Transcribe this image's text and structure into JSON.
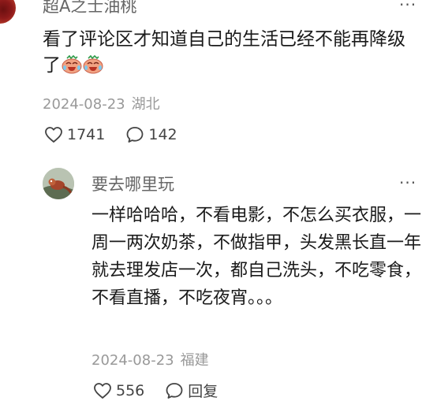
{
  "top_comment": {
    "username": "超A之士油桃",
    "text": "看了评论区才知道自己的生活已经不能再降级了",
    "emoji_count": 2,
    "date": "2024-08-23",
    "location": "湖北",
    "likes": "1741",
    "replies": "142"
  },
  "reply": {
    "username": "要去哪里玩",
    "text": "一样哈哈哈，不看电影，不怎么买衣服，一周一两次奶茶，不做指甲，头发黑长直一年就去理发店一次，都自己洗头，不吃零食，不看直播，不吃夜宵。。。",
    "date": "2024-08-23",
    "location": "福建",
    "likes": "556",
    "reply_label": "回复"
  },
  "icons": {
    "more": "more-dots-icon",
    "like": "heart-outline-icon",
    "comment": "speech-bubble-icon",
    "emoji": "crying-laughing-emoji-icon"
  },
  "colors": {
    "text_primary": "#1a1a1a",
    "text_secondary": "#666666",
    "text_meta": "#999999",
    "emoji_fill": "#f1a282"
  }
}
